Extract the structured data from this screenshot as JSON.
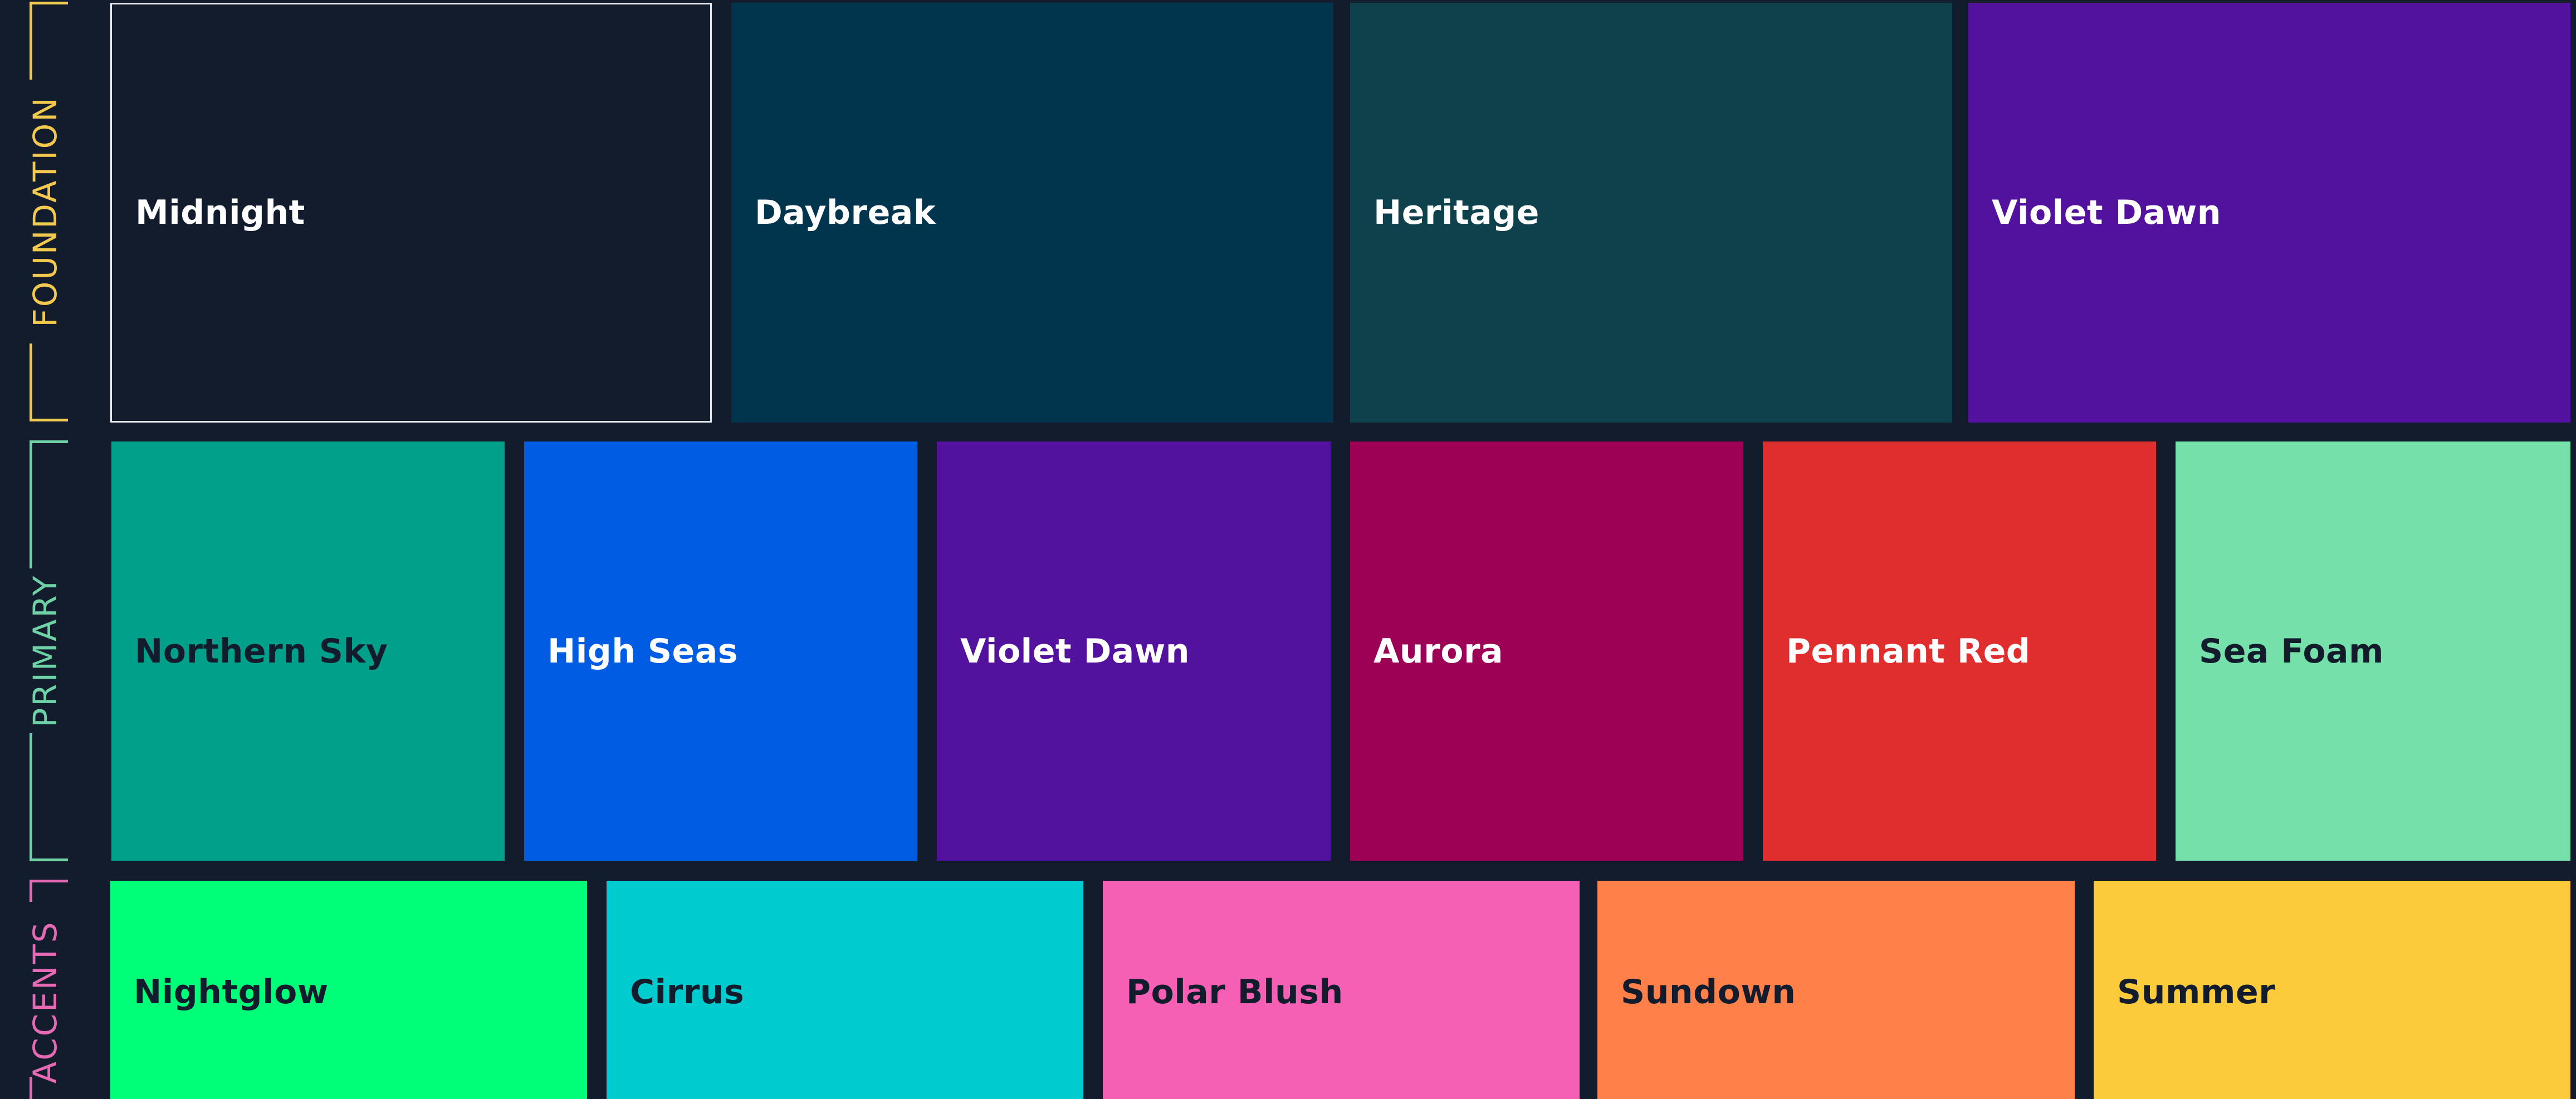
{
  "groups": {
    "foundation": {
      "label": "FOUNDATION",
      "color": "#F2C94C"
    },
    "primary": {
      "label": "PRIMARY",
      "color": "#6FD1A6"
    },
    "accents": {
      "label": "ACCENTS",
      "color": "#E56AB3"
    }
  },
  "foundation": [
    {
      "name": "Midnight",
      "color": "#121C2D",
      "text_color": "#FFFFFF",
      "outlined": true
    },
    {
      "name": "Daybreak",
      "color": "#01344D",
      "text_color": "#FFFFFF"
    },
    {
      "name": "Heritage",
      "color": "#0F414D",
      "text_color": "#FFFFFF"
    },
    {
      "name": "Violet Dawn",
      "color": "#52129D",
      "text_color": "#FFFFFF"
    }
  ],
  "primary": [
    {
      "name": "Northern Sky",
      "color": "#01A08B",
      "text_color": "#121C2D"
    },
    {
      "name": "High Seas",
      "color": "#005DE3",
      "text_color": "#FFFFFF"
    },
    {
      "name": "Violet Dawn",
      "color": "#52129D",
      "text_color": "#FFFFFF"
    },
    {
      "name": "Aurora",
      "color": "#9C0155",
      "text_color": "#FFFFFF"
    },
    {
      "name": "Pennant Red",
      "color": "#E02E2E",
      "text_color": "#FFFFFF"
    },
    {
      "name": "Sea Foam",
      "color": "#75E0AA",
      "text_color": "#121C2D"
    }
  ],
  "accents": [
    {
      "name": "Nightglow",
      "color": "#00FF79",
      "text_color": "#121C2D"
    },
    {
      "name": "Cirrus",
      "color": "#00CCCF",
      "text_color": "#121C2D"
    },
    {
      "name": "Polar Blush",
      "color": "#F55FB4",
      "text_color": "#121C2D"
    },
    {
      "name": "Sundown",
      "color": "#FF8049",
      "text_color": "#121C2D"
    },
    {
      "name": "Summer",
      "color": "#FCCB3B",
      "text_color": "#121C2D"
    }
  ]
}
